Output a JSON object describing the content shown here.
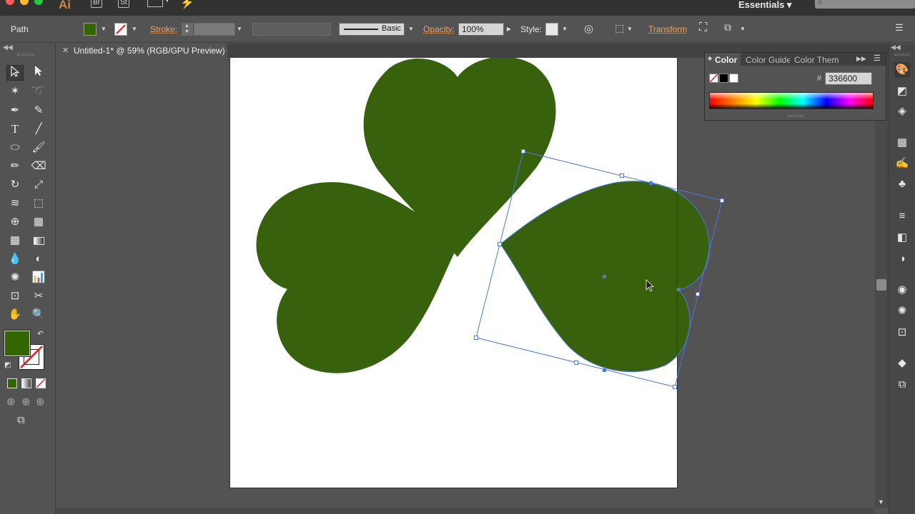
{
  "app": {
    "logo": "Ai",
    "bridge_label": "Br",
    "stock_label": "St",
    "workspace": "Essentials ▾"
  },
  "control_bar": {
    "selection_label": "Path",
    "fill_color": "#336600",
    "stroke_label": "Stroke:",
    "stroke_style_label": "Basic",
    "opacity_label": "Opacity:",
    "opacity_value": "100%",
    "style_label": "Style:",
    "transform_label": "Transform"
  },
  "document": {
    "tab_close": "✕",
    "tab_title": "Untitled-1* @ 59% (RGB/GPU Preview)"
  },
  "toolbar": {
    "tools": [
      "selection-tool",
      "direct-selection-tool",
      "magic-wand-tool",
      "lasso-tool",
      "pen-tool",
      "curvature-tool",
      "type-tool",
      "line-segment-tool",
      "ellipse-tool",
      "paintbrush-tool",
      "pencil-tool",
      "eraser-tool",
      "rotate-tool",
      "scale-tool",
      "width-tool",
      "free-transform-tool",
      "shape-builder-tool",
      "perspective-grid-tool",
      "mesh-tool",
      "gradient-tool",
      "eyedropper-tool",
      "blend-tool",
      "symbol-sprayer-tool",
      "column-graph-tool",
      "artboard-tool",
      "slice-tool",
      "hand-tool",
      "zoom-tool"
    ],
    "fill_color": "#336600",
    "stroke_color": "none"
  },
  "color_panel": {
    "tab_color": "Color",
    "tab_guide": "Color Guide",
    "tab_themes": "Color Themes",
    "hex_label": "#",
    "hex_value": "336600"
  },
  "colors": {
    "leaf_fill": "#37610d",
    "selection_blue": "#4a7bd8",
    "accent_orange": "#f0a35e"
  }
}
